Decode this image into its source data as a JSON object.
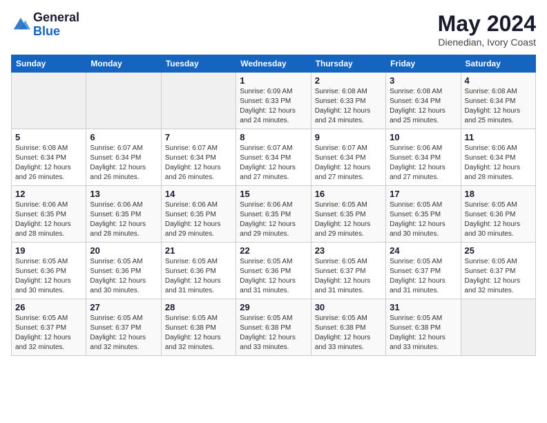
{
  "logo": {
    "line1": "General",
    "line2": "Blue"
  },
  "title": {
    "month_year": "May 2024",
    "location": "Dienedian, Ivory Coast"
  },
  "days_of_week": [
    "Sunday",
    "Monday",
    "Tuesday",
    "Wednesday",
    "Thursday",
    "Friday",
    "Saturday"
  ],
  "weeks": [
    [
      {
        "day": "",
        "info": ""
      },
      {
        "day": "",
        "info": ""
      },
      {
        "day": "",
        "info": ""
      },
      {
        "day": "1",
        "info": "Sunrise: 6:09 AM\nSunset: 6:33 PM\nDaylight: 12 hours\nand 24 minutes."
      },
      {
        "day": "2",
        "info": "Sunrise: 6:08 AM\nSunset: 6:33 PM\nDaylight: 12 hours\nand 24 minutes."
      },
      {
        "day": "3",
        "info": "Sunrise: 6:08 AM\nSunset: 6:34 PM\nDaylight: 12 hours\nand 25 minutes."
      },
      {
        "day": "4",
        "info": "Sunrise: 6:08 AM\nSunset: 6:34 PM\nDaylight: 12 hours\nand 25 minutes."
      }
    ],
    [
      {
        "day": "5",
        "info": "Sunrise: 6:08 AM\nSunset: 6:34 PM\nDaylight: 12 hours\nand 26 minutes."
      },
      {
        "day": "6",
        "info": "Sunrise: 6:07 AM\nSunset: 6:34 PM\nDaylight: 12 hours\nand 26 minutes."
      },
      {
        "day": "7",
        "info": "Sunrise: 6:07 AM\nSunset: 6:34 PM\nDaylight: 12 hours\nand 26 minutes."
      },
      {
        "day": "8",
        "info": "Sunrise: 6:07 AM\nSunset: 6:34 PM\nDaylight: 12 hours\nand 27 minutes."
      },
      {
        "day": "9",
        "info": "Sunrise: 6:07 AM\nSunset: 6:34 PM\nDaylight: 12 hours\nand 27 minutes."
      },
      {
        "day": "10",
        "info": "Sunrise: 6:06 AM\nSunset: 6:34 PM\nDaylight: 12 hours\nand 27 minutes."
      },
      {
        "day": "11",
        "info": "Sunrise: 6:06 AM\nSunset: 6:34 PM\nDaylight: 12 hours\nand 28 minutes."
      }
    ],
    [
      {
        "day": "12",
        "info": "Sunrise: 6:06 AM\nSunset: 6:35 PM\nDaylight: 12 hours\nand 28 minutes."
      },
      {
        "day": "13",
        "info": "Sunrise: 6:06 AM\nSunset: 6:35 PM\nDaylight: 12 hours\nand 28 minutes."
      },
      {
        "day": "14",
        "info": "Sunrise: 6:06 AM\nSunset: 6:35 PM\nDaylight: 12 hours\nand 29 minutes."
      },
      {
        "day": "15",
        "info": "Sunrise: 6:06 AM\nSunset: 6:35 PM\nDaylight: 12 hours\nand 29 minutes."
      },
      {
        "day": "16",
        "info": "Sunrise: 6:05 AM\nSunset: 6:35 PM\nDaylight: 12 hours\nand 29 minutes."
      },
      {
        "day": "17",
        "info": "Sunrise: 6:05 AM\nSunset: 6:35 PM\nDaylight: 12 hours\nand 30 minutes."
      },
      {
        "day": "18",
        "info": "Sunrise: 6:05 AM\nSunset: 6:36 PM\nDaylight: 12 hours\nand 30 minutes."
      }
    ],
    [
      {
        "day": "19",
        "info": "Sunrise: 6:05 AM\nSunset: 6:36 PM\nDaylight: 12 hours\nand 30 minutes."
      },
      {
        "day": "20",
        "info": "Sunrise: 6:05 AM\nSunset: 6:36 PM\nDaylight: 12 hours\nand 30 minutes."
      },
      {
        "day": "21",
        "info": "Sunrise: 6:05 AM\nSunset: 6:36 PM\nDaylight: 12 hours\nand 31 minutes."
      },
      {
        "day": "22",
        "info": "Sunrise: 6:05 AM\nSunset: 6:36 PM\nDaylight: 12 hours\nand 31 minutes."
      },
      {
        "day": "23",
        "info": "Sunrise: 6:05 AM\nSunset: 6:37 PM\nDaylight: 12 hours\nand 31 minutes."
      },
      {
        "day": "24",
        "info": "Sunrise: 6:05 AM\nSunset: 6:37 PM\nDaylight: 12 hours\nand 31 minutes."
      },
      {
        "day": "25",
        "info": "Sunrise: 6:05 AM\nSunset: 6:37 PM\nDaylight: 12 hours\nand 32 minutes."
      }
    ],
    [
      {
        "day": "26",
        "info": "Sunrise: 6:05 AM\nSunset: 6:37 PM\nDaylight: 12 hours\nand 32 minutes."
      },
      {
        "day": "27",
        "info": "Sunrise: 6:05 AM\nSunset: 6:37 PM\nDaylight: 12 hours\nand 32 minutes."
      },
      {
        "day": "28",
        "info": "Sunrise: 6:05 AM\nSunset: 6:38 PM\nDaylight: 12 hours\nand 32 minutes."
      },
      {
        "day": "29",
        "info": "Sunrise: 6:05 AM\nSunset: 6:38 PM\nDaylight: 12 hours\nand 33 minutes."
      },
      {
        "day": "30",
        "info": "Sunrise: 6:05 AM\nSunset: 6:38 PM\nDaylight: 12 hours\nand 33 minutes."
      },
      {
        "day": "31",
        "info": "Sunrise: 6:05 AM\nSunset: 6:38 PM\nDaylight: 12 hours\nand 33 minutes."
      },
      {
        "day": "",
        "info": ""
      }
    ]
  ]
}
